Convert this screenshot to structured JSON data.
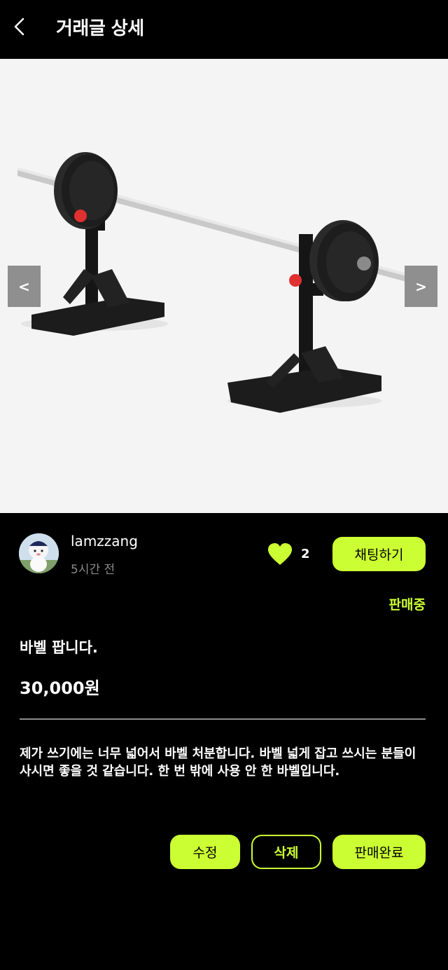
{
  "header": {
    "title": "거래글 상세",
    "back_icon": "chevron-left-icon"
  },
  "gallery": {
    "image_subject": "barbell on squat stands",
    "prev_label": "<",
    "next_label": ">"
  },
  "seller": {
    "name": "lamzzang",
    "posted": "5시간 전"
  },
  "likes": {
    "icon": "heart-icon",
    "count": "2"
  },
  "buttons": {
    "chat": "채팅하기",
    "edit": "수정",
    "delete": "삭제",
    "complete": "판매완료"
  },
  "post": {
    "status": "판매중",
    "title": "바벨 팝니다.",
    "price": "30,000원",
    "description": "제가 쓰기에는 너무 넓어서 바벨 처분합니다. 바벨 넓게 잡고 쓰시는 분들이 사시면 좋을 것 같습니다. 한 번 밖에 사용 안 한 바벨입니다."
  },
  "colors": {
    "accent": "#ccff33",
    "background": "#000000",
    "muted_text": "#8a8a8a"
  }
}
